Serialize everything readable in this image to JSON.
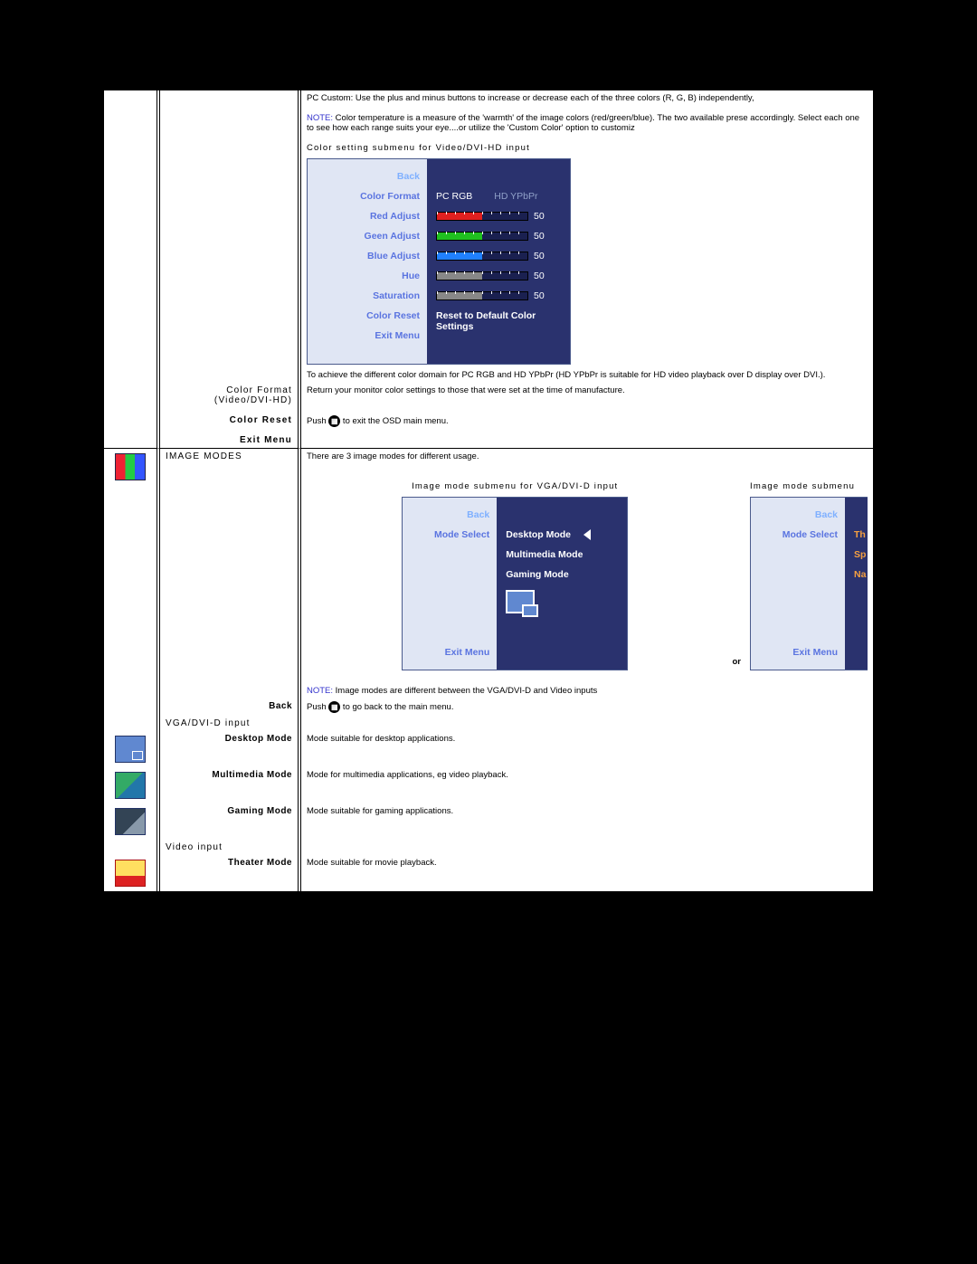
{
  "top": {
    "pcCustom": "PC Custom: Use the plus and minus buttons to increase or decrease each of the three colors (R, G, B) independently,",
    "noteLabel": "NOTE:",
    "noteText": " Color temperature is a measure of the 'warmth' of the image colors (red/green/blue). The two available prese accordingly. Select each one to see how each range suits your eye....or utilize the 'Custom Color' option to customiz",
    "submenuTitle": "Color setting submenu for Video/DVI-HD input",
    "achieve": "To achieve the different color domain for PC RGB and HD YPbPr (HD YPbPr is suitable for HD video playback over D display over DVI.).",
    "colorFormatLabel1": "Color Format",
    "colorFormatLabel2": "(Video/DVI-HD)",
    "colorFormatDesc": "Return your monitor color settings to those that were set at the time of manufacture.",
    "pushExitPre": "Push ",
    "pushExitPost": " to exit the OSD main menu.",
    "colorReset": "Color Reset",
    "exitMenu": "Exit Menu"
  },
  "osd1": {
    "back": "Back",
    "colorFormat": "Color Format",
    "red": "Red Adjust",
    "green": "Geen Adjust",
    "blue": "Blue Adjust",
    "hue": "Hue",
    "sat": "Saturation",
    "reset": "Color Reset",
    "exit": "Exit Menu",
    "pcrgb": "PC RGB",
    "hdypbpr": "HD YPbPr",
    "val": "50",
    "resetText": "Reset to Default Color Settings"
  },
  "modes": {
    "header": "IMAGE MODES",
    "intro": "There are 3 image modes for different usage.",
    "cap1": "Image mode submenu for VGA/DVI-D input",
    "cap2": "Image mode submenu",
    "or": "or",
    "noteLabel": "NOTE:",
    "noteText": " Image modes are different between the VGA/DVI-D and Video inputs",
    "backLabel": "Back",
    "backTextPre": "Push ",
    "backTextPost": " to go back to the main menu.",
    "vgaHeader": "VGA/DVI-D input",
    "desktop": "Desktop Mode",
    "desktopDesc": "Mode suitable for desktop applications.",
    "multi": "Multimedia Mode",
    "multiDesc": "Mode for multimedia applications, eg video playback.",
    "game": "Gaming Mode",
    "gameDesc": "Mode suitable for gaming applications.",
    "videoHeader": "Video input",
    "theater": "Theater Mode",
    "theaterDesc": "Mode suitable for movie playback."
  },
  "osd2": {
    "back": "Back",
    "modeSelect": "Mode Select",
    "exit": "Exit Menu",
    "desktop": "Desktop Mode",
    "multi": "Multimedia Mode",
    "game": "Gaming Mode"
  },
  "osd3": {
    "back": "Back",
    "modeSelect": "Mode Select",
    "exit": "Exit Menu",
    "o1": "Th",
    "o2": "Sp",
    "o3": "Na"
  }
}
